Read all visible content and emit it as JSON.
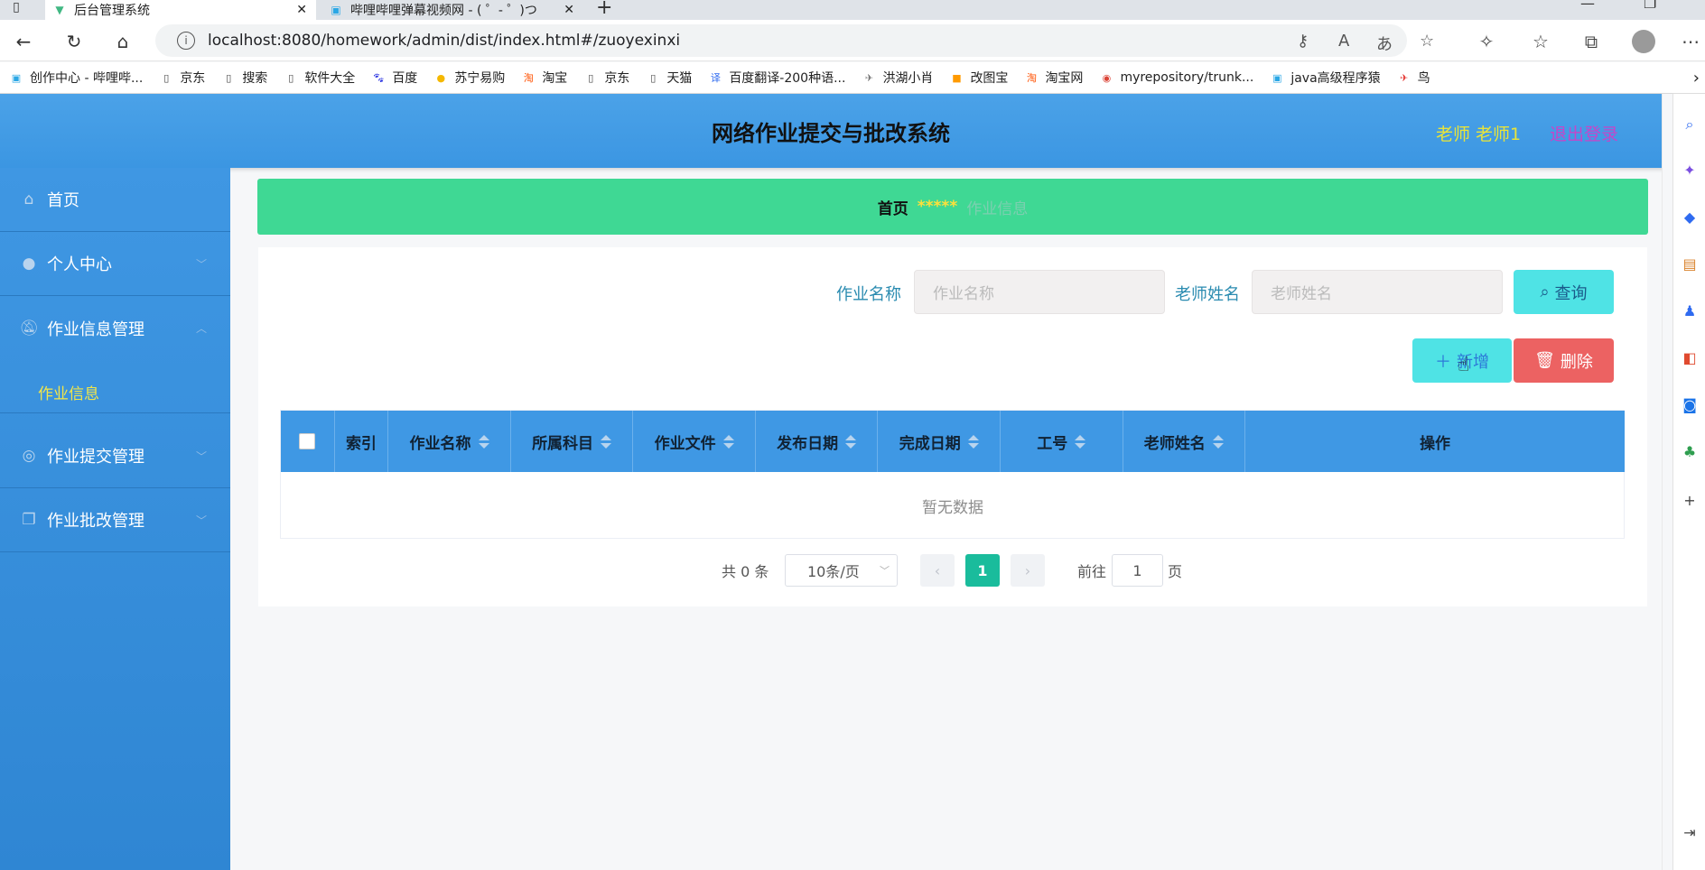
{
  "browser": {
    "tabs": [
      {
        "title": "后台管理系统",
        "active": true
      },
      {
        "title": "哔哩哔哩弹幕视频网 - ( ゜- ゜)つ",
        "active": false
      }
    ],
    "url": "localhost:8080/homework/admin/dist/index.html#/zuoyexinxi",
    "bookmarks": [
      {
        "label": "创作中心 - 哔哩哔...",
        "icon": "bilibili-icon",
        "color": "#2aa7e5"
      },
      {
        "label": "京东",
        "icon": "page-icon",
        "color": ""
      },
      {
        "label": "搜索",
        "icon": "page-icon",
        "color": ""
      },
      {
        "label": "软件大全",
        "icon": "page-icon",
        "color": ""
      },
      {
        "label": "百度",
        "icon": "baidu-icon",
        "color": "#2932e1"
      },
      {
        "label": "苏宁易购",
        "icon": "suning-icon",
        "color": "#f5b800"
      },
      {
        "label": "淘宝",
        "icon": "taobao-icon",
        "color": "#ff5000"
      },
      {
        "label": "京东",
        "icon": "page-icon",
        "color": ""
      },
      {
        "label": "天猫",
        "icon": "page-icon",
        "color": ""
      },
      {
        "label": "百度翻译-200种语...",
        "icon": "translate-icon",
        "color": "#2f6bf0"
      },
      {
        "label": "洪湖小肖",
        "icon": "bird-icon",
        "color": "#777"
      },
      {
        "label": "改图宝",
        "icon": "gaitubao-icon",
        "color": "#ff9a00"
      },
      {
        "label": "淘宝网",
        "icon": "taobao-icon",
        "color": "#ff5000"
      },
      {
        "label": "myrepository/trunk...",
        "icon": "chrome-icon",
        "color": "#db4437"
      },
      {
        "label": "java高级程序猿",
        "icon": "bilibili-icon",
        "color": "#2aa7e5"
      },
      {
        "label": "鸟",
        "icon": "bird-icon",
        "color": "#e53935"
      }
    ]
  },
  "header": {
    "title": "网络作业提交与批改系统",
    "user": "老师 老师1",
    "logout": "退出登录"
  },
  "sidebar": {
    "items": [
      {
        "label": "首页",
        "icon": "home-icon"
      },
      {
        "label": "个人中心",
        "icon": "user-icon"
      },
      {
        "label": "作业信息管理",
        "icon": "bell-off-icon"
      },
      {
        "label": "作业提交管理",
        "icon": "target-icon"
      },
      {
        "label": "作业批改管理",
        "icon": "copy-icon"
      }
    ],
    "sub_item": "作业信息"
  },
  "breadcrumb": {
    "home": "首页",
    "separator": "*****",
    "current": "作业信息"
  },
  "search": {
    "name_label": "作业名称",
    "name_placeholder": "作业名称",
    "teacher_label": "老师姓名",
    "teacher_placeholder": "老师姓名",
    "button": "查询"
  },
  "actions": {
    "add": "新增",
    "delete": "删除"
  },
  "table": {
    "columns": [
      "索引",
      "作业名称",
      "所属科目",
      "作业文件",
      "发布日期",
      "完成日期",
      "工号",
      "老师姓名",
      "操作"
    ],
    "empty_text": "暂无数据"
  },
  "pagination": {
    "total": "共 0 条",
    "page_size": "10条/页",
    "current_page": "1",
    "goto_label": "前往",
    "goto_value": "1",
    "page_unit": "页"
  },
  "colors": {
    "header": "#3f98e4",
    "breadcrumb": "#3fd894",
    "accent_button": "#4fe3e5",
    "delete_button": "#ec6262",
    "active_page": "#1abc9c"
  }
}
